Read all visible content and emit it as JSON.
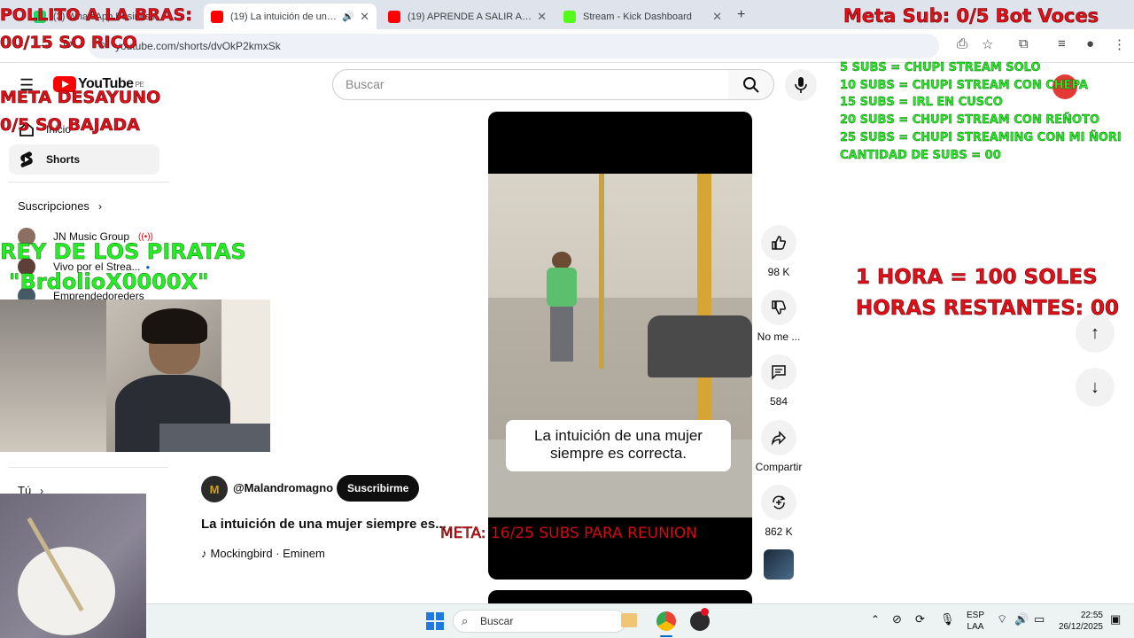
{
  "browser": {
    "tabs": [
      {
        "title": "(3) WhatsApp Business",
        "active": false,
        "favicon_color": "#25d366"
      },
      {
        "title": "(19) La intuición de una mujer",
        "active": true,
        "favicon_color": "#ff0000"
      },
      {
        "title": "(19) APRENDE A SALIR ADELANTE",
        "active": false,
        "favicon_color": "#ff0000"
      },
      {
        "title": "Stream - Kick Dashboard",
        "active": false,
        "favicon_color": "#53fc18"
      }
    ],
    "new_tab": "+",
    "url": "youtube.com/shorts/dvOkP2kmxSk"
  },
  "youtube": {
    "logo_text": "YouTube",
    "region": "PE",
    "search_placeholder": "Buscar",
    "sidebar": {
      "home": "Inicio",
      "shorts": "Shorts",
      "subscriptions_header": "Suscripciones",
      "subscriptions": [
        "JN Music Group",
        "Vivo por el Strea...",
        "Emprendedoreders"
      ],
      "you": "Tú"
    },
    "channel": {
      "handle": "@Malandromagno",
      "subscribe": "Suscribirme"
    },
    "video_title": "La intuición de una mujer siempre es...",
    "music": "Mockingbird · Eminem",
    "video_caption": "La intuición de una mujer siempre es correcta.",
    "actions": {
      "likes": "98 K",
      "dislike": "No me ...",
      "comments": "584",
      "share": "Compartir",
      "remix": "862 K"
    }
  },
  "overlays": {
    "top_left": [
      "POLLITO A LA BRAS:",
      "00/15 SO RICO"
    ],
    "breakfast": [
      "META DESAYUNO",
      "0/5 SO BAJADA"
    ],
    "meta_sub": "Meta Sub: 0/5 Bot Voces",
    "sub_goals": [
      "5 SUBS = CHUPI STREAM SOLO",
      "10 SUBS = CHUPI STREAM CON CHEPA",
      "15 SUBS = IRL EN CUSCO",
      "20 SUBS = CHUPI STREAM CON REÑOTO",
      "25 SUBS = CHUPI STREAMING CON MI ÑORI",
      "CANTIDAD DE SUBS = 00"
    ],
    "hours": [
      "1 HORA = 100 SOLES",
      "HORAS RESTANTES: 00"
    ],
    "pirates": [
      "REY DE LOS PIRATAS",
      "\"BrdolioX0000X\""
    ],
    "meta_reunion": "META: 16/25 SUBS PARA REUNION"
  },
  "taskbar": {
    "search": "Buscar",
    "lang": [
      "ESP",
      "LAA"
    ],
    "time": "22:55",
    "date": "26/12/2025"
  },
  "colors": {
    "overlay_red": "#e0101a",
    "overlay_green": "#22ee22",
    "youtube_red": "#ff0000"
  }
}
